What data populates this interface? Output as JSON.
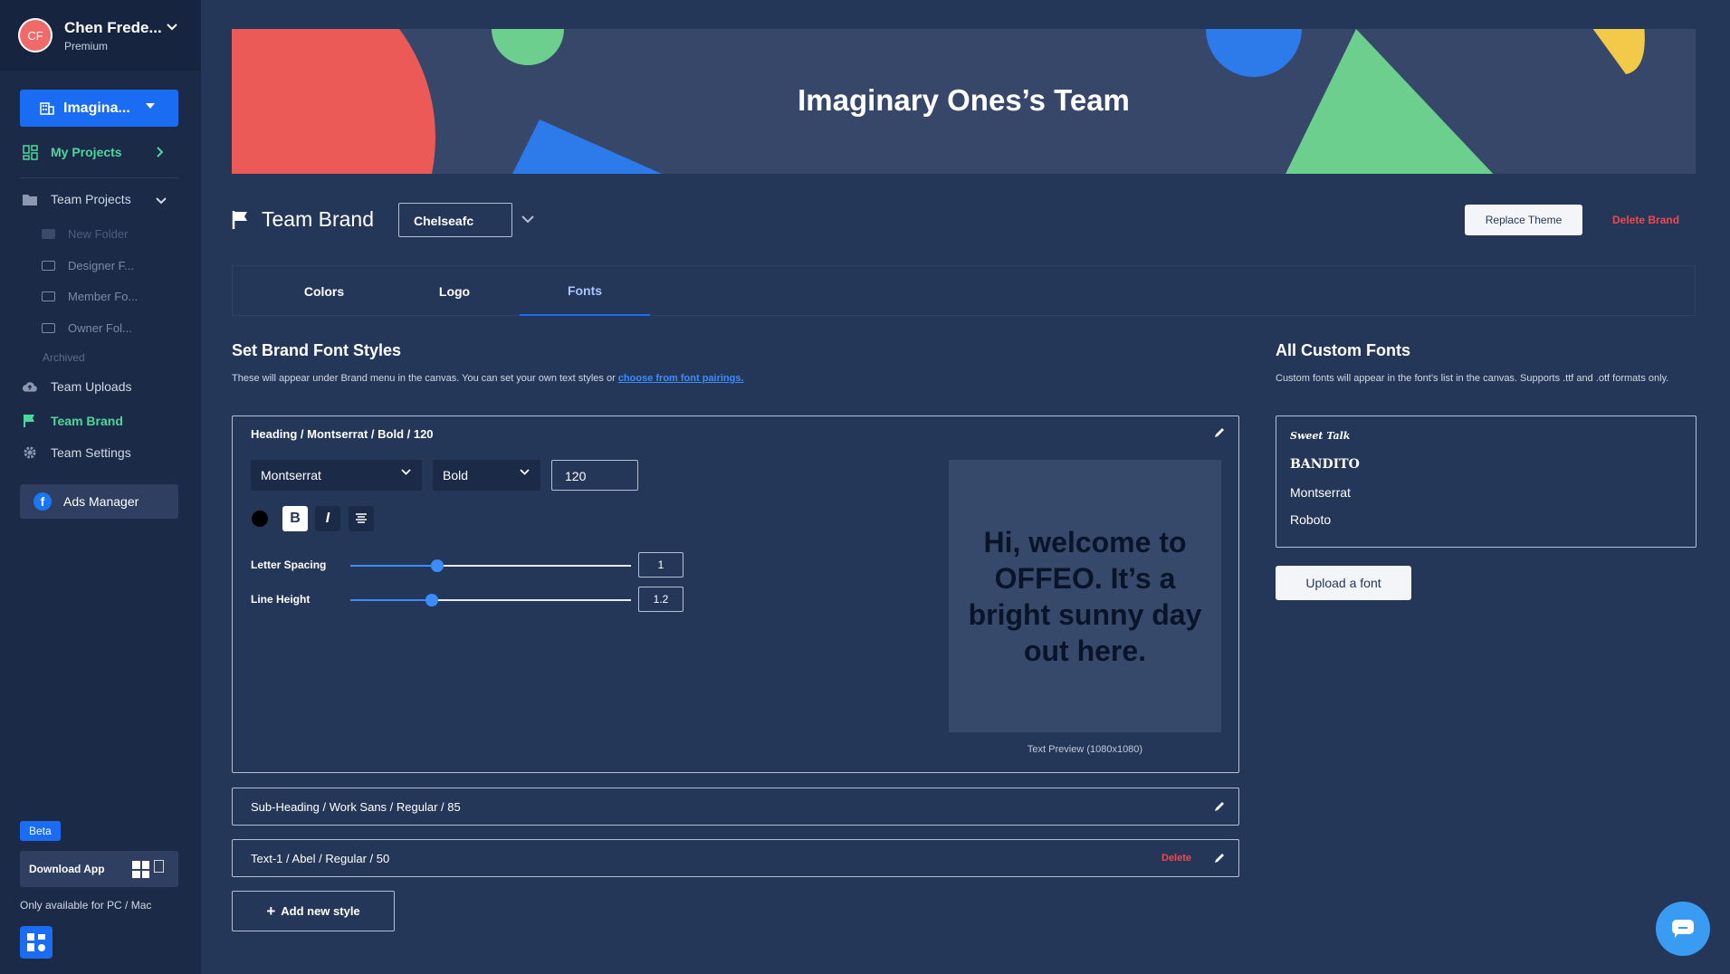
{
  "user": {
    "initials": "CF",
    "name": "Chen Frede...",
    "plan": "Premium"
  },
  "sidebar": {
    "team_select": "Imagina...",
    "my_projects": "My Projects",
    "team_projects": "Team Projects",
    "folders": [
      "New Folder",
      "Designer F...",
      "Member Fo...",
      "Owner Fol..."
    ],
    "archived": "Archived",
    "team_uploads": "Team Uploads",
    "team_brand": "Team Brand",
    "team_settings": "Team Settings",
    "ads_manager": "Ads Manager",
    "beta": "Beta",
    "download_app": "Download App",
    "only_available": "Only available for PC / Mac"
  },
  "banner": {
    "title": "Imaginary Ones’s Team"
  },
  "brand": {
    "title": "Team Brand",
    "selected": "Chelseafc",
    "replace_theme": "Replace Theme",
    "delete_brand": "Delete Brand"
  },
  "tabs": [
    "Colors",
    "Logo",
    "Fonts"
  ],
  "font_styles": {
    "title": "Set Brand Font Styles",
    "desc": "These will appear under Brand menu in the canvas. You can set your own text styles or ",
    "link": "choose from font pairings.",
    "active_style": {
      "header": "Heading / Montserrat / Bold / 120",
      "font": "Montserrat",
      "weight": "Bold",
      "size": "120",
      "letter_spacing_label": "Letter Spacing",
      "letter_spacing": "1",
      "letter_spacing_level": 0.31,
      "line_height_label": "Line Height",
      "line_height": "1.2",
      "line_height_level": 0.29,
      "preview_text": "Hi, welcome to OFFEO. It’s a bright sunny day out here.",
      "preview_caption": "Text Preview (1080x1080)"
    },
    "styles": [
      {
        "label": "Sub-Heading / Work Sans / Regular / 85"
      },
      {
        "label": "Text-1 / Abel / Regular / 50",
        "delete": "Delete"
      }
    ],
    "add_new": "Add new style"
  },
  "custom_fonts": {
    "title": "All Custom Fonts",
    "desc": "Custom fonts will appear in the font’s list in the canvas. Supports .ttf and .otf formats only.",
    "fonts": [
      "Sweet Talk",
      "BANDITO",
      "Montserrat",
      "Roboto"
    ],
    "upload": "Upload a font"
  },
  "colors": {
    "accent": "#1a6cf3",
    "green": "#4ed79c",
    "danger": "#f0484e",
    "bg": "#253758"
  }
}
